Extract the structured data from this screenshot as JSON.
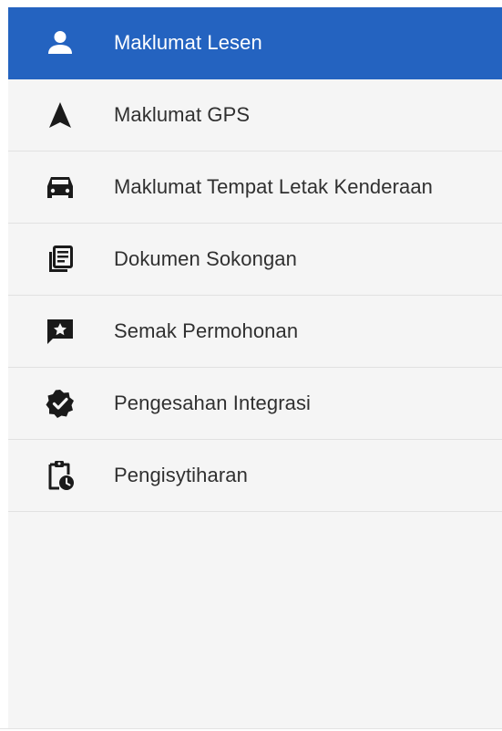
{
  "menu": {
    "items": [
      {
        "label": "Maklumat Lesen",
        "icon": "person-icon",
        "active": true
      },
      {
        "label": "Maklumat GPS",
        "icon": "navigation-arrow-icon",
        "active": false
      },
      {
        "label": "Maklumat Tempat Letak Kenderaan",
        "icon": "car-icon",
        "active": false
      },
      {
        "label": "Dokumen Sokongan",
        "icon": "document-library-icon",
        "active": false
      },
      {
        "label": "Semak Permohonan",
        "icon": "review-chat-icon",
        "active": false
      },
      {
        "label": "Pengesahan Integrasi",
        "icon": "verified-badge-icon",
        "active": false
      },
      {
        "label": "Pengisytiharan",
        "icon": "clipboard-clock-icon",
        "active": false
      }
    ]
  },
  "colors": {
    "active_background": "#2463c0",
    "menu_background": "#f5f5f5",
    "divider": "#e1e1e1",
    "text": "#303030",
    "icon": "#1a1a1a"
  }
}
